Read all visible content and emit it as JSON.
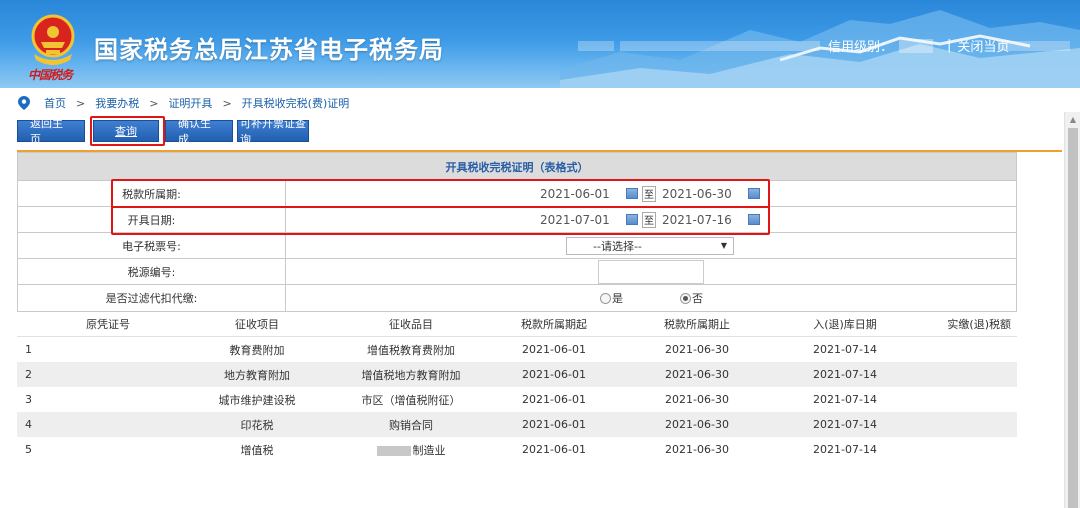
{
  "header": {
    "site_title": "国家税务总局江苏省电子税务局",
    "brand_script": "中国税务",
    "credit_label": "信用级别：",
    "separator": "|",
    "close_label": "关闭当页"
  },
  "breadcrumb": {
    "items": [
      "首页",
      "我要办税",
      "证明开具",
      "开具税收完税(费)证明"
    ],
    "separator": ">"
  },
  "toolbar": {
    "back_label": "返回主页",
    "query_label": "查询",
    "confirm_label": "确认生成",
    "extra_label": "可补开票证查询"
  },
  "form": {
    "title": "开具税收完税证明（表格式）",
    "tax_period_label": "税款所属期:",
    "tax_period_start": "2021-06-01",
    "tax_period_end": "2021-06-30",
    "issue_date_label": "开具日期:",
    "issue_date_start": "2021-07-01",
    "issue_date_end": "2021-07-16",
    "to_label": "至",
    "ticket_label": "电子税票号:",
    "ticket_select": "--请选择--",
    "source_label": "税源编号:",
    "filter_label": "是否过滤代扣代缴:",
    "yes_label": "是",
    "no_label": "否",
    "selected": "否"
  },
  "grid": {
    "headers": [
      "原凭证号",
      "征收项目",
      "征收品目",
      "税款所属期起",
      "税款所属期止",
      "入(退)库日期",
      "实缴(退)税额"
    ],
    "rows": [
      {
        "no": "1",
        "item": "教育费附加",
        "category": "增值税教育费附加",
        "start": "2021-06-01",
        "end": "2021-06-30",
        "date": "2021-07-14"
      },
      {
        "no": "2",
        "item": "地方教育附加",
        "category": "增值税地方教育附加",
        "start": "2021-06-01",
        "end": "2021-06-30",
        "date": "2021-07-14"
      },
      {
        "no": "3",
        "item": "城市维护建设税",
        "category": "市区（增值税附征）",
        "start": "2021-06-01",
        "end": "2021-06-30",
        "date": "2021-07-14"
      },
      {
        "no": "4",
        "item": "印花税",
        "category": "购销合同",
        "start": "2021-06-01",
        "end": "2021-06-30",
        "date": "2021-07-14"
      },
      {
        "no": "5",
        "item": "增值税",
        "category": "制造业",
        "start": "2021-06-01",
        "end": "2021-06-30",
        "date": "2021-07-14"
      }
    ]
  },
  "colors": {
    "header_blue": "#2a86d8",
    "button_blue": "#225fb0",
    "highlight_red": "#e01515",
    "accent_orange": "#f0a030"
  }
}
